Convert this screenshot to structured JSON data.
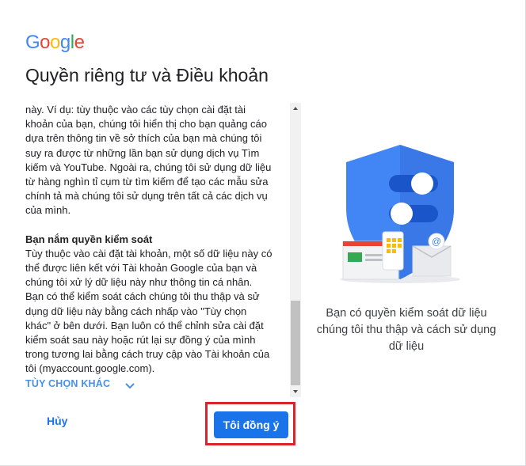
{
  "brand": {
    "logo_text": "Google",
    "logo_letters": [
      {
        "ch": "G",
        "color": "#4285F4"
      },
      {
        "ch": "o",
        "color": "#EA4335"
      },
      {
        "ch": "o",
        "color": "#FBBC05"
      },
      {
        "ch": "g",
        "color": "#4285F4"
      },
      {
        "ch": "l",
        "color": "#34A853"
      },
      {
        "ch": "e",
        "color": "#EA4335"
      }
    ]
  },
  "page": {
    "title": "Quyền riêng tư và Điều khoản"
  },
  "terms": {
    "paragraph1": "này. Ví dụ: tùy thuộc vào các tùy chọn cài đặt tài khoản của bạn, chúng tôi hiển thị cho bạn quảng cáo dựa trên thông tin về sở thích của bạn mà chúng tôi suy ra được từ những lần bạn sử dụng dịch vụ Tìm kiếm và YouTube. Ngoài ra, chúng tôi sử dụng dữ liệu từ hàng nghìn tỉ cụm từ tìm kiếm để tạo các mẫu sửa chính tả mà chúng tôi sử dụng trên tất cả các dịch vụ của mình.",
    "heading2": "Bạn nắm quyền kiểm soát",
    "paragraph2": "Tùy thuộc vào cài đặt tài khoản, một số dữ liệu này có thể được liên kết với Tài khoản Google của bạn và chúng tôi xử lý dữ liệu này như thông tin cá nhân. Bạn có thể kiểm soát cách chúng tôi thu thập và sử dụng dữ liệu này bằng cách nhấp vào \"Tùy chọn khác\" ở bên dưới. Bạn luôn có thể chỉnh sửa cài đặt kiểm soát sau này hoặc rút lại sự đồng ý của mình trong tương lai bằng cách truy cập vào Tài khoản của tôi (myaccount.google.com).",
    "more_options_label": "TÙY CHỌN KHÁC"
  },
  "actions": {
    "cancel_label": "Hủy",
    "agree_label": "Tôi đồng ý"
  },
  "illustration": {
    "caption": "Bạn có quyền kiểm soát dữ liệu chúng tôi thu thập và cách sử dụng dữ liệu"
  },
  "colors": {
    "accent": "#1a73e8",
    "link": "#4a90e2",
    "highlight_border": "#d9232d",
    "shield": "#4285F4"
  },
  "icons": [
    "chevron-down-icon",
    "scroll-up-arrow-icon",
    "scroll-down-arrow-icon",
    "privacy-shield-illustration"
  ]
}
